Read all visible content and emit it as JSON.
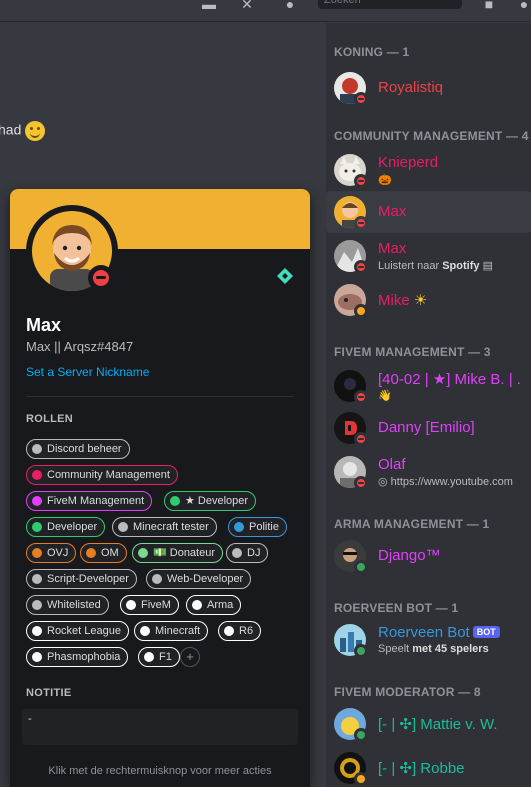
{
  "topbar": {
    "search_placeholder": "Zoeken",
    "icons": [
      "bell-icon",
      "pin-icon",
      "members-icon",
      "inbox-icon",
      "help-icon"
    ]
  },
  "chat": {
    "fragment_text": "had",
    "emoji": "slightly-smiling-face"
  },
  "members": {
    "sections": [
      {
        "title": "KONING — 1"
      },
      {
        "title": "COMMUNITY MANAGEMENT — 4"
      },
      {
        "title": "FIVEM MANAGEMENT — 3"
      },
      {
        "title": "ARMA MANAGEMENT — 1"
      },
      {
        "title": "ROERVEEN BOT — 1"
      },
      {
        "title": "FIVEM MODERATOR — 8"
      }
    ],
    "list": [
      {
        "name": "Royalistiq",
        "sub": "",
        "color": "#ed4245",
        "status": "dnd"
      },
      {
        "name": "Knieperd",
        "sub": "",
        "color": "#e91e63",
        "status": "dnd"
      },
      {
        "name": "Max",
        "sub": "",
        "color": "#e91e63",
        "status": "dnd"
      },
      {
        "name": "Max",
        "sub_prefix": "Luistert naar",
        "sub_bold": "Spotify",
        "color": "#e91e63",
        "status": "dnd"
      },
      {
        "name": "Mike",
        "sub": "",
        "color": "#e91e63",
        "status": "idle"
      },
      {
        "name": "[40-02 | ★] Mike B. | .",
        "sub": "",
        "color": "#e040fb",
        "status": "dnd"
      },
      {
        "name": "Danny [Emilio]",
        "sub": "",
        "color": "#e040fb",
        "status": "dnd"
      },
      {
        "name": "Olaf",
        "sub": "https://www.youtube.com",
        "color": "#e040fb",
        "status": "dnd"
      },
      {
        "name": "Django™",
        "sub": "",
        "color": "#e040fb",
        "status": "on"
      },
      {
        "name": "Roerveen Bot",
        "bot": "BOT",
        "sub_prefix": "Speelt",
        "sub_bold": "met 45 spelers",
        "color": "#3498db",
        "status": "on"
      },
      {
        "name": "[- | ✣] Mattie v. W.",
        "sub": "",
        "color": "#1abc9c",
        "status": "on"
      },
      {
        "name": "[- | ✣] Robbe",
        "sub": "",
        "color": "#1abc9c",
        "status": "idle"
      }
    ]
  },
  "profile": {
    "display_name": "Max",
    "tag": "Max || Arqsz#4847",
    "nickname_link": "Set a Server Nickname",
    "roles_header": "ROLLEN",
    "roles": [
      {
        "label": "Discord beheer",
        "color": "#b9bbbe"
      },
      {
        "label": "Community Management",
        "color": "#e91e63"
      },
      {
        "label": "FiveM Management",
        "color": "#e040fb"
      },
      {
        "label": "★ Developer",
        "color": "#2ecc71"
      },
      {
        "label": "Developer",
        "color": "#2ecc71"
      },
      {
        "label": "Minecraft tester",
        "color": "#b9bbbe"
      },
      {
        "label": "Politie",
        "color": "#3498db"
      },
      {
        "label": "OVJ",
        "color": "#e67e22"
      },
      {
        "label": "OM",
        "color": "#e67e22"
      },
      {
        "label": "💵 Donateur",
        "color": "#7bd88f"
      },
      {
        "label": "DJ",
        "color": "#b9bbbe"
      },
      {
        "label": "Script-Developer",
        "color": "#b9bbbe"
      },
      {
        "label": "Web-Developer",
        "color": "#b9bbbe"
      },
      {
        "label": "Whitelisted",
        "color": "#b9bbbe"
      },
      {
        "label": "FiveM",
        "color": "#ffffff"
      },
      {
        "label": "Arma",
        "color": "#ffffff"
      },
      {
        "label": "Rocket League",
        "color": "#ffffff"
      },
      {
        "label": "Minecraft",
        "color": "#ffffff"
      },
      {
        "label": "R6",
        "color": "#ffffff"
      },
      {
        "label": "Phasmophobia",
        "color": "#ffffff"
      },
      {
        "label": "F1",
        "color": "#ffffff"
      }
    ],
    "add_role": "+",
    "note_header": "NOTITIE",
    "note_value": "-",
    "hint": "Klik met de rechtermuisknop voor meer acties"
  }
}
